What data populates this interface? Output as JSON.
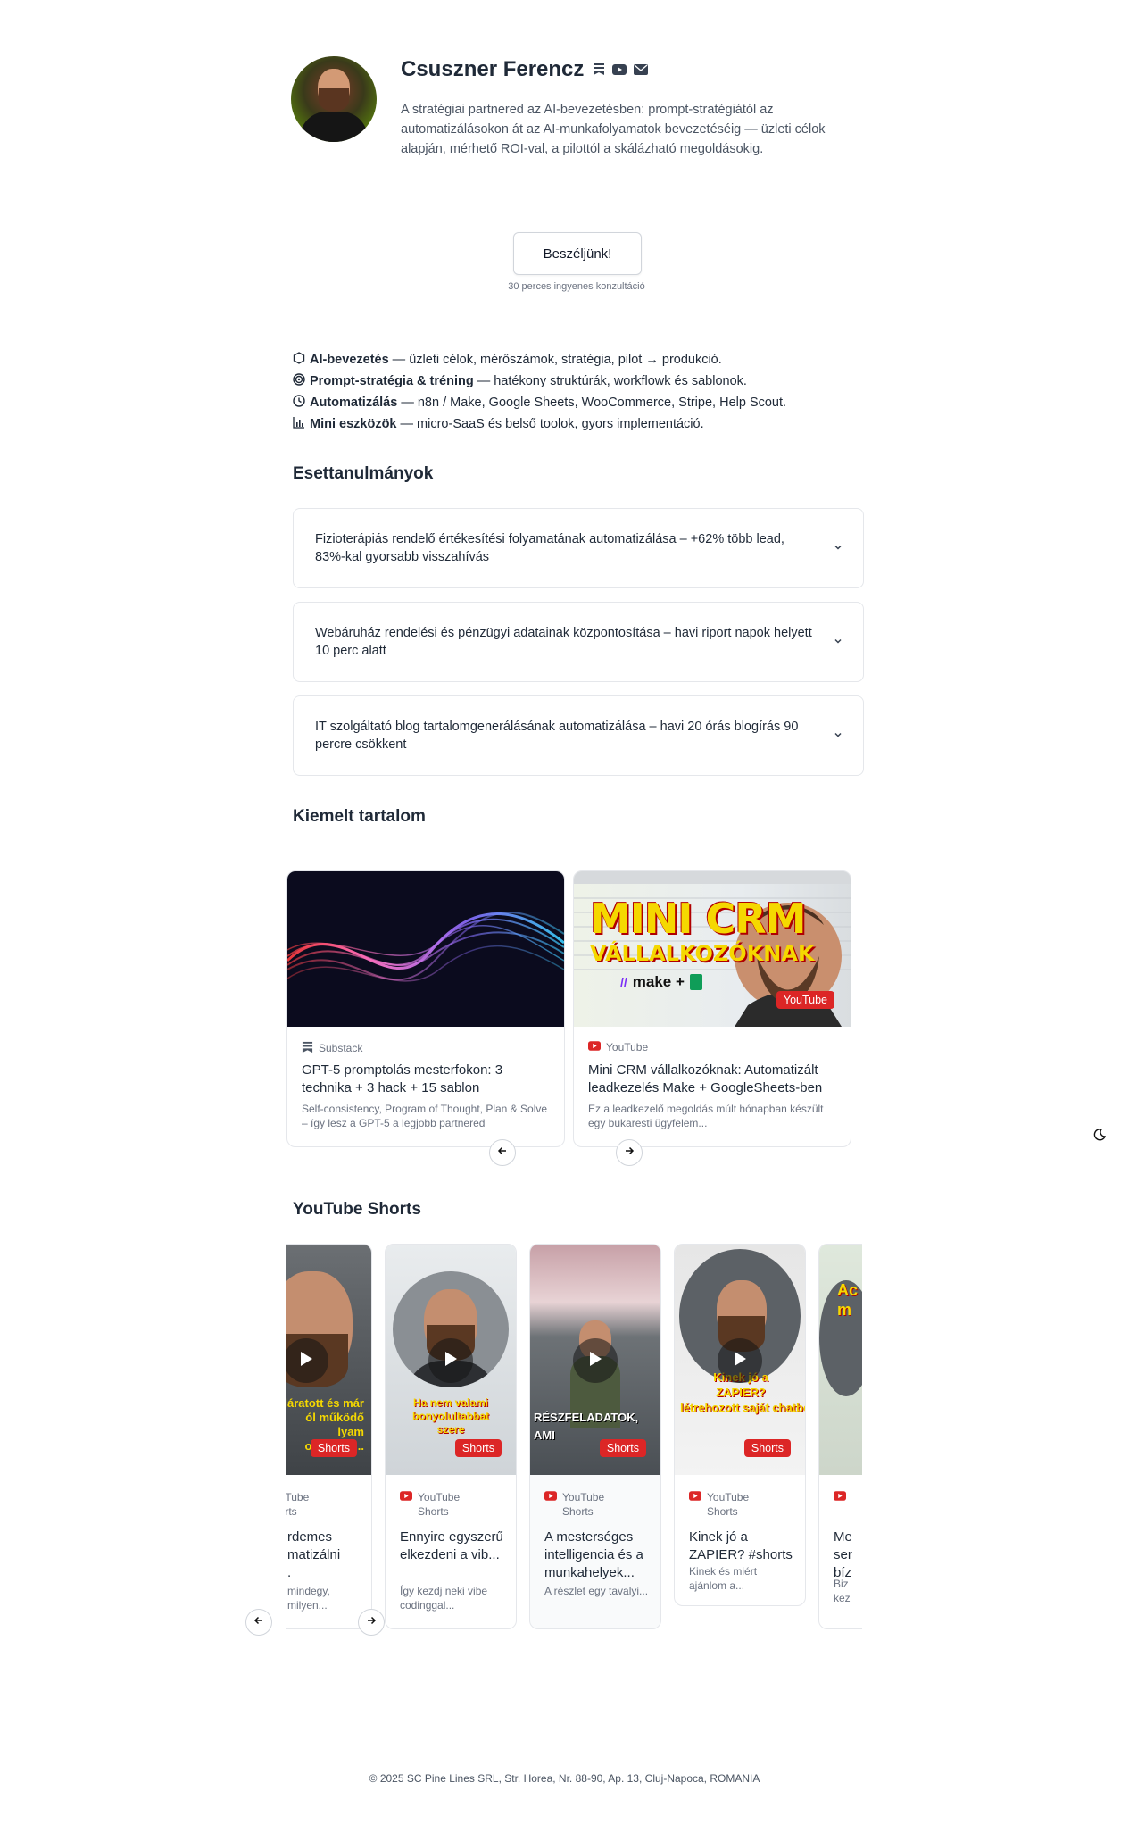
{
  "profile": {
    "name": "Csuszner Ferencz",
    "bio": "A stratégiai partnered az AI-bevezetésben: prompt-stratégiától az automatizálásokon át az AI-munkafolyamatok bevezetéséig — üzleti célok alapján, mérhető ROI-val, a pilottól a skálázható megoldásokig.",
    "social_icons": [
      "substack-icon",
      "youtube-icon",
      "mail-icon"
    ]
  },
  "cta": {
    "label": "Beszéljünk!",
    "sub": "30 perces ingyenes konzultáció"
  },
  "features": [
    {
      "icon": "hexagon-icon",
      "title": "AI-bevezetés",
      "text": " — üzleti célok, mérőszámok, stratégia, pilot → produkció."
    },
    {
      "icon": "target-icon",
      "title": "Prompt-stratégia & tréning",
      "text": " — hatékony struktúrák, workflowk és sablonok."
    },
    {
      "icon": "clock-icon",
      "title": "Automatizálás",
      "text": " — n8n / Make, Google Sheets, WooCommerce, Stripe, Help Scout."
    },
    {
      "icon": "bar-chart-icon",
      "title": "Mini eszközök",
      "text": " — micro-SaaS és belső toolok, gyors implementáció."
    }
  ],
  "case_studies": {
    "heading": "Esettanulmányok",
    "items": [
      {
        "title": "Fizioterápiás rendelő értékesítési folyamatának automatizálása – +62% több lead, 83%-kal gyorsabb visszahívás"
      },
      {
        "title": "Webáruház rendelési és pénzügyi adatainak központosítása – havi riport napok helyett 10 perc alatt"
      },
      {
        "title": "IT szolgáltató blog tartalomgenerálásának automatizálása – havi 20 órás blogírás 90 percre csökkent"
      }
    ]
  },
  "featured": {
    "heading": "Kiemelt tartalom",
    "cards": [
      {
        "source": "Substack",
        "title": "GPT-5 promptolás mesterfokon: 3 technika + 3 hack + 15 sablon",
        "desc": "Self-consistency, Program of Thought, Plan & Solve – így lesz a GPT-5 a legjobb partnered"
      },
      {
        "source": "YouTube",
        "badge": "YouTube",
        "thumb_title": "MINI CRM",
        "thumb_subtitle": "VÁLLALKOZÓKNAK",
        "thumb_brand": "make +",
        "title": "Mini CRM vállalkozóknak: Automatizált leadkezelés Make + GoogleSheets-ben",
        "desc": "Ez a leadkezelő megoldás múlt hónapban készült egy bukaresti ügyfelem..."
      }
    ]
  },
  "shorts": {
    "heading": "YouTube Shorts",
    "badge": "Shorts",
    "items": [
      {
        "source_line1": "ouTube",
        "source_line2": "horts",
        "title": "rdemes\nmatizálni\n.",
        "desc": " mindegy,\nmilyen...",
        "caption": "eláratott és már\nól működő\nlyam\nomatizálj..."
      },
      {
        "source_line1": "YouTube",
        "source_line2": "Shorts",
        "title": "Ennyire egyszerű elkezdeni a vib...",
        "desc": "Így kezdj neki vibe codinggal...",
        "caption": "Ha nem valami\nbonyolultabbat\nszere"
      },
      {
        "source_line1": "YouTube",
        "source_line2": "Shorts",
        "title": "A mesterséges intelligencia és a munkahelyek...",
        "desc": "A részlet egy tavalyi...",
        "caption": "RÉSZFELADATOK,\nAMI"
      },
      {
        "source_line1": "YouTube",
        "source_line2": "Shorts",
        "title": "Kinek jó a ZAPIER? #shorts",
        "desc": "Kinek és miért ajánlom a...",
        "caption": "Kinek jó a\nZAPIER?\nlétrehozott saját chatbot"
      },
      {
        "source_line1": "",
        "source_line2": "",
        "title": "Me\nser\nbíz",
        "desc": "Biz\nkez",
        "caption": "Ac\nm"
      }
    ]
  },
  "footer": "© 2025 SC Pine Lines SRL, Str. Horea, Nr. 88-90, Ap. 13, Cluj-Napoca, ROMANIA",
  "colors": {
    "accent_red": "#dc2626",
    "text": "#1f2937",
    "muted": "#6b7280",
    "border": "#e5e7eb"
  }
}
